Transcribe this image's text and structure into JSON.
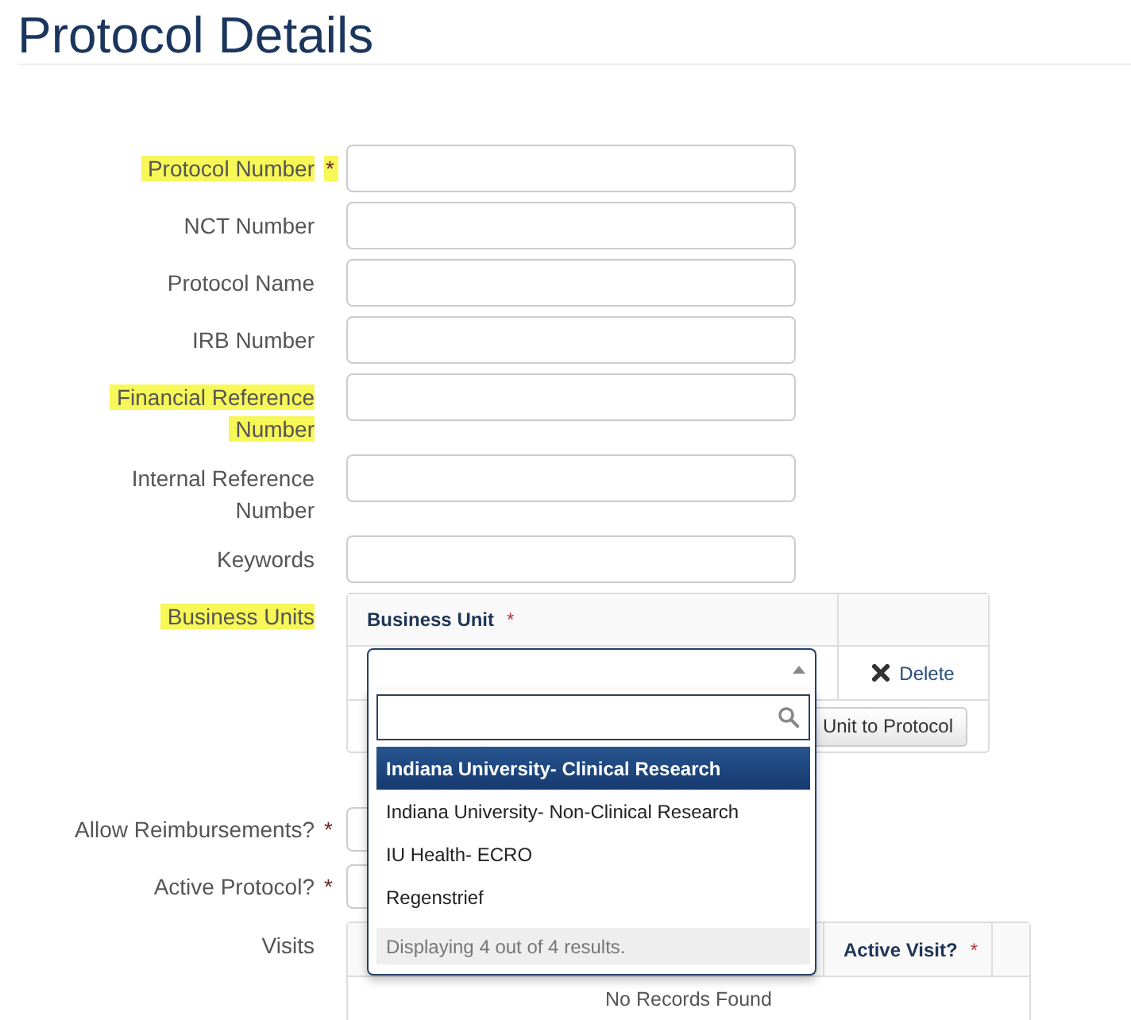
{
  "page": {
    "title": "Protocol Details"
  },
  "fields": [
    {
      "kind": "text",
      "label": "Protocol Number",
      "required_mark": "*",
      "highlighted": true
    },
    {
      "kind": "text",
      "label": "NCT Number",
      "highlighted": false
    },
    {
      "kind": "text",
      "label": "Protocol Name",
      "highlighted": false
    },
    {
      "kind": "text",
      "label": "IRB Number",
      "highlighted": false
    },
    {
      "kind": "text",
      "label": "Financial Reference Number",
      "highlighted": true
    },
    {
      "kind": "text",
      "label": "Internal Reference Number",
      "highlighted": false
    },
    {
      "kind": "text",
      "label": "Keywords",
      "highlighted": false
    },
    {
      "kind": "unit_table",
      "label": "Business Units",
      "highlighted": true,
      "columns": [
        {
          "label": "Business Unit",
          "required_mark": "*"
        }
      ],
      "rows": [
        {
          "select": {
            "expanded": true,
            "options": [
              {
                "label": "Indiana University- Clinical Research",
                "selected": true
              },
              {
                "label": "Indiana University- Non-Clinical Research",
                "selected": false
              },
              {
                "label": "IU Health- ECRO",
                "selected": false
              },
              {
                "label": "Regenstrief",
                "selected": false
              }
            ],
            "status": "Displaying 4 out of 4 results."
          },
          "action": "Delete"
        }
      ],
      "add_button": "Unit to Protocol"
    },
    {
      "kind": "select",
      "label": "Allow Reimbursements?",
      "required_mark": "*",
      "highlighted": false
    },
    {
      "kind": "select",
      "label": "Active Protocol?",
      "required_mark": "*",
      "highlighted": false
    },
    {
      "kind": "visit_table",
      "label": "Visits",
      "highlighted": false,
      "columns": [
        {
          "label": "Active Visit?",
          "required_mark": "*"
        }
      ],
      "empty_message": "No Records Found"
    }
  ]
}
